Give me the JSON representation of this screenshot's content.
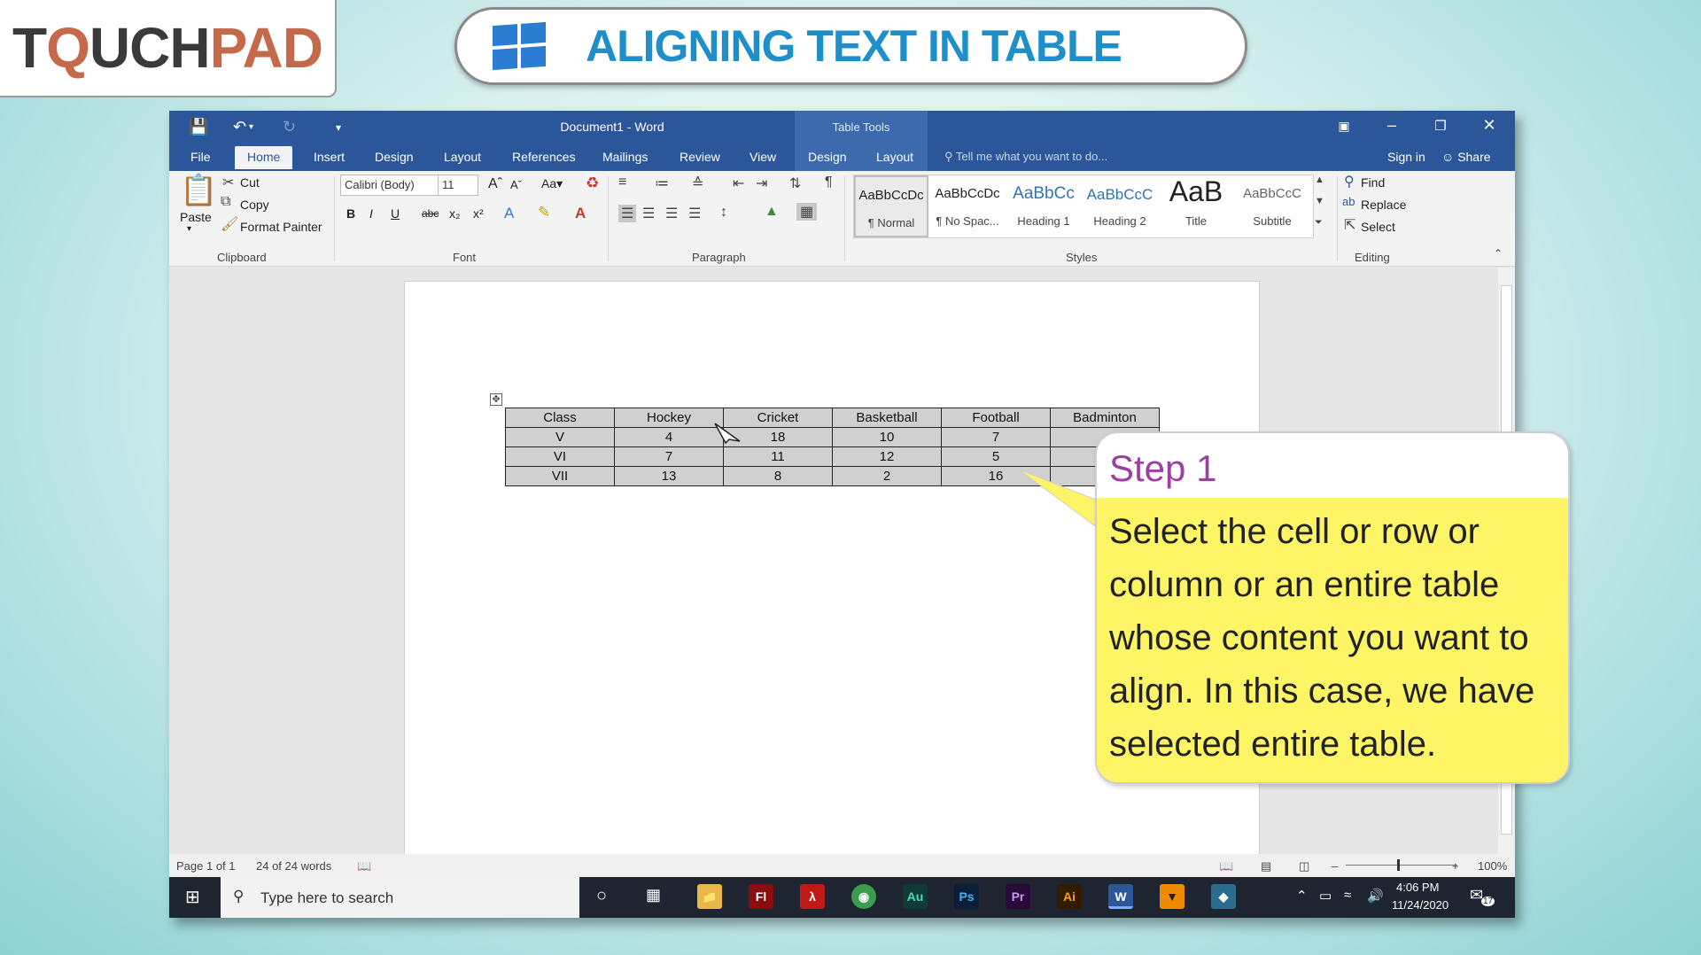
{
  "brand": {
    "part1": "T",
    "part2": "Q",
    "part3": "UCH",
    "part4": "PAD"
  },
  "header_title": "ALIGNING TEXT IN TABLE",
  "word": {
    "doc_title": "Document1 - Word",
    "table_tools": "Table Tools",
    "tabs": [
      "File",
      "Home",
      "Insert",
      "Design",
      "Layout",
      "References",
      "Mailings",
      "Review",
      "View",
      "Design",
      "Layout"
    ],
    "tell_me": "Tell me what you want to do...",
    "sign_in": "Sign in",
    "share": "Share",
    "clipboard": {
      "paste": "Paste",
      "cut": "Cut",
      "copy": "Copy",
      "format_painter": "Format Painter",
      "label": "Clipboard"
    },
    "font": {
      "name": "Calibri (Body)",
      "size": "11",
      "label": "Font"
    },
    "paragraph_label": "Paragraph",
    "styles": [
      {
        "sample": "AaBbCcDc",
        "name": "¶ Normal"
      },
      {
        "sample": "AaBbCcDc",
        "name": "¶ No Spac..."
      },
      {
        "sample": "AaBbCc",
        "name": "Heading 1"
      },
      {
        "sample": "AaBbCcC",
        "name": "Heading 2"
      },
      {
        "sample": "AaB",
        "name": "Title"
      },
      {
        "sample": "AaBbCcC",
        "name": "Subtitle"
      }
    ],
    "styles_label": "Styles",
    "editing": {
      "find": "Find",
      "replace": "Replace",
      "select": "Select",
      "label": "Editing"
    },
    "table": {
      "headers": [
        "Class",
        "Hockey",
        "Cricket",
        "Basketball",
        "Football",
        "Badminton"
      ],
      "rows": [
        [
          "V",
          "4",
          "18",
          "10",
          "7",
          ""
        ],
        [
          "VI",
          "7",
          "11",
          "12",
          "5",
          ""
        ],
        [
          "VII",
          "13",
          "8",
          "2",
          "16",
          ""
        ]
      ]
    },
    "status": {
      "page": "Page 1 of 1",
      "words": "24 of 24 words",
      "zoom": "100%"
    }
  },
  "taskbar": {
    "search_placeholder": "Type here to search",
    "time": "4:06 PM",
    "date": "11/24/2020",
    "notifications": "17"
  },
  "callout": {
    "heading": "Step 1",
    "body": "Select the cell or row or column or an entire table whose content you want to align. In this case, we have selected entire table."
  }
}
